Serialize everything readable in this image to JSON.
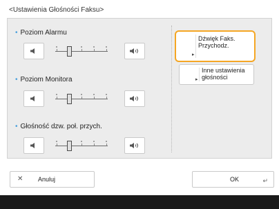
{
  "title": "<Ustawienia Głośności Faksu>",
  "sections": [
    {
      "label": "Poziom Alarmu",
      "level": 2,
      "steps": 5
    },
    {
      "label": "Poziom Monitora",
      "level": 2,
      "steps": 5
    },
    {
      "label": "Głośność dzw. poł. przych.",
      "level": 2,
      "steps": 5
    }
  ],
  "side_buttons": [
    {
      "label": "Dźwięk Faks.\nPrzychodz.",
      "selected": true
    },
    {
      "label": "Inne ustawienia\ngłośności",
      "selected": false
    }
  ],
  "bottom": {
    "cancel_label": "Anuluj",
    "ok_label": "OK"
  },
  "colors": {
    "accent_bullet": "#4aa0dc",
    "highlight": "#f5a623",
    "footer": "#1a1a1a"
  }
}
